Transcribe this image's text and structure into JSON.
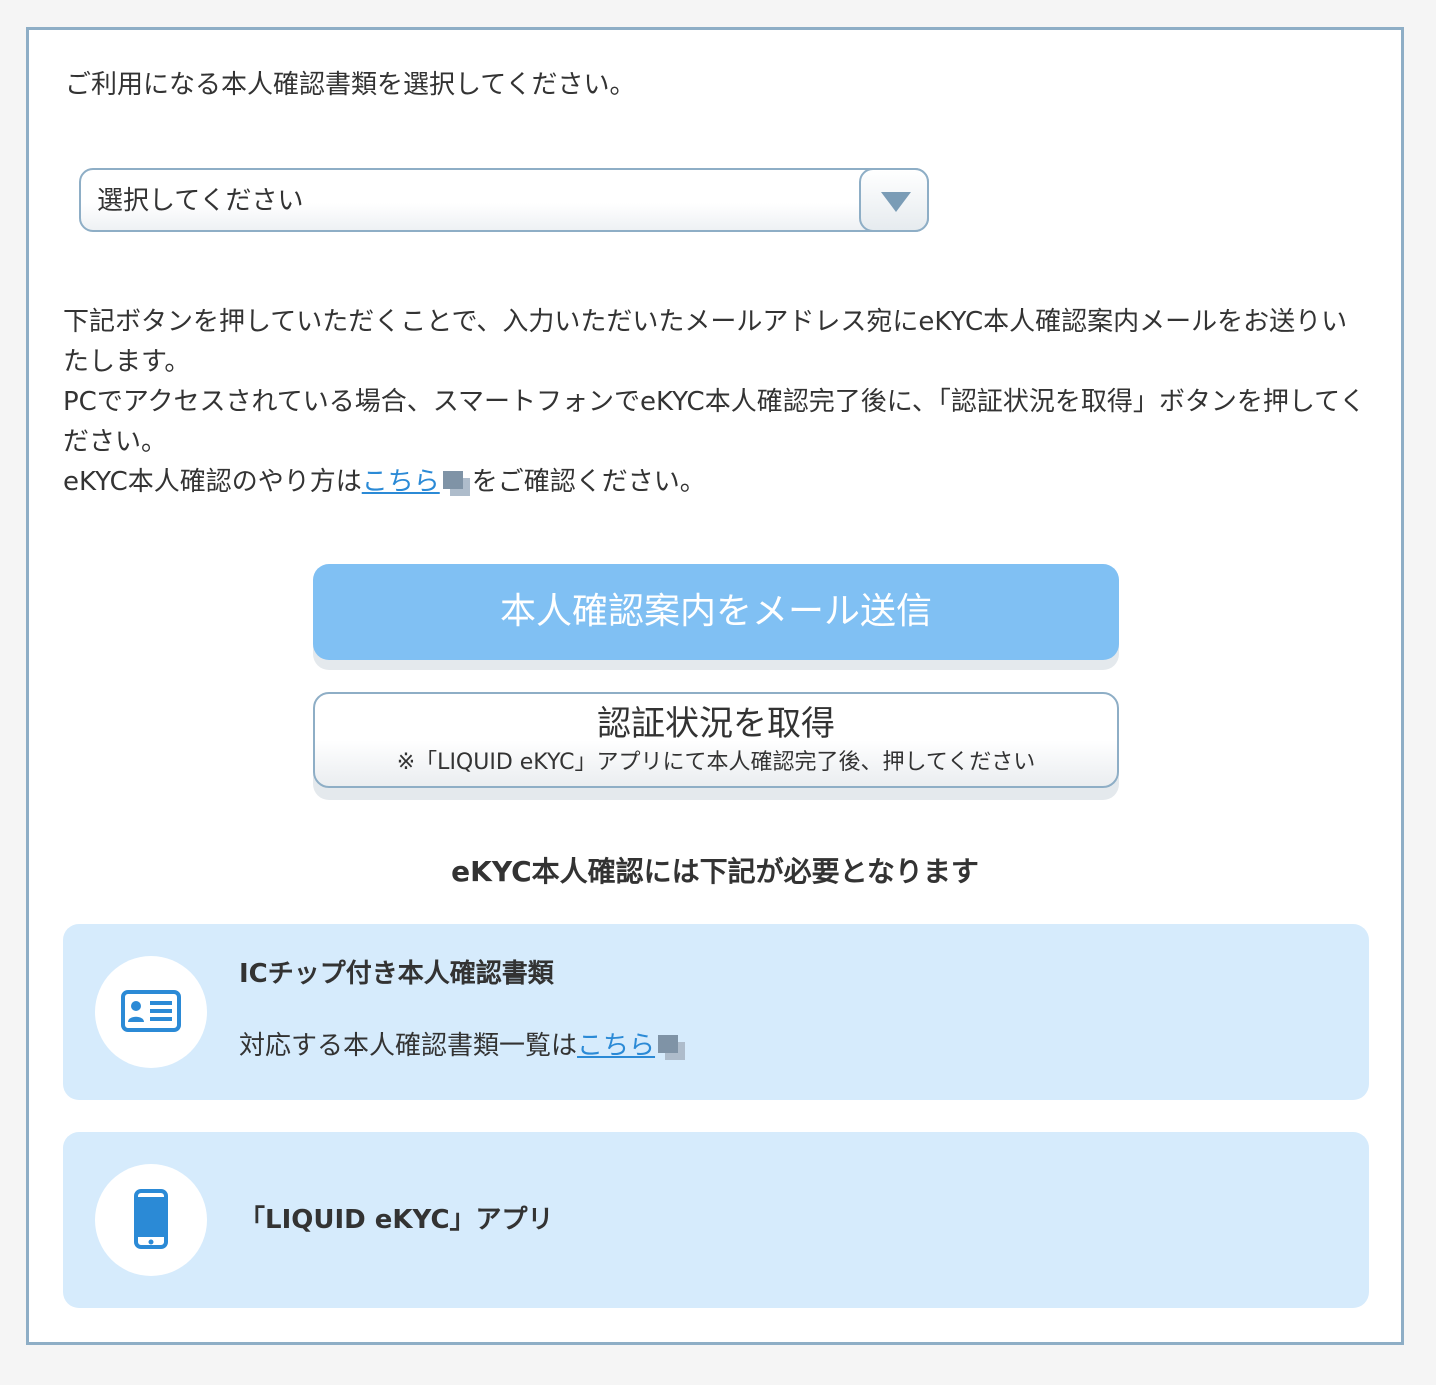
{
  "intro_text": "ご利用になる本人確認書類を選択してください。",
  "document_select": {
    "value": "選択してください",
    "arrow_icon": "triangle-down-icon"
  },
  "description": {
    "line1": "下記ボタンを押していただくことで、入力いただいたメールアドレス宛にeKYC本人確認案内メールをお送りいたします。",
    "line2": "PCでアクセスされている場合、スマートフォンでeKYC本人確認完了後に、「認証状況を取得」ボタンを押してください。",
    "line3_prefix": "eKYC本人確認のやり方は",
    "line3_link": "こちら",
    "line3_suffix": "をご確認ください。",
    "external_icon": "external-window-icon"
  },
  "buttons": {
    "send_mail": "本人確認案内をメール送信",
    "get_status": "認証状況を取得",
    "get_status_note": "※「LIQUID eKYC」アプリにて本人確認完了後、押してください"
  },
  "requirements": {
    "heading": "eKYC本人確認には下記が必要となります",
    "items": [
      {
        "icon": "id-card-icon",
        "title": "ICチップ付き本人確認書類",
        "text_prefix": "対応する本人確認書類一覧は",
        "link": "こちら"
      },
      {
        "icon": "smartphone-icon",
        "title": "「LIQUID eKYC」アプリ"
      }
    ]
  },
  "colors": {
    "accent_blue": "#80c0f3",
    "border_blue_gray": "#8eaec6",
    "card_background": "#d6ebfc",
    "link_blue": "#2b8ad6",
    "icon_blue": "#2b8ad6"
  }
}
